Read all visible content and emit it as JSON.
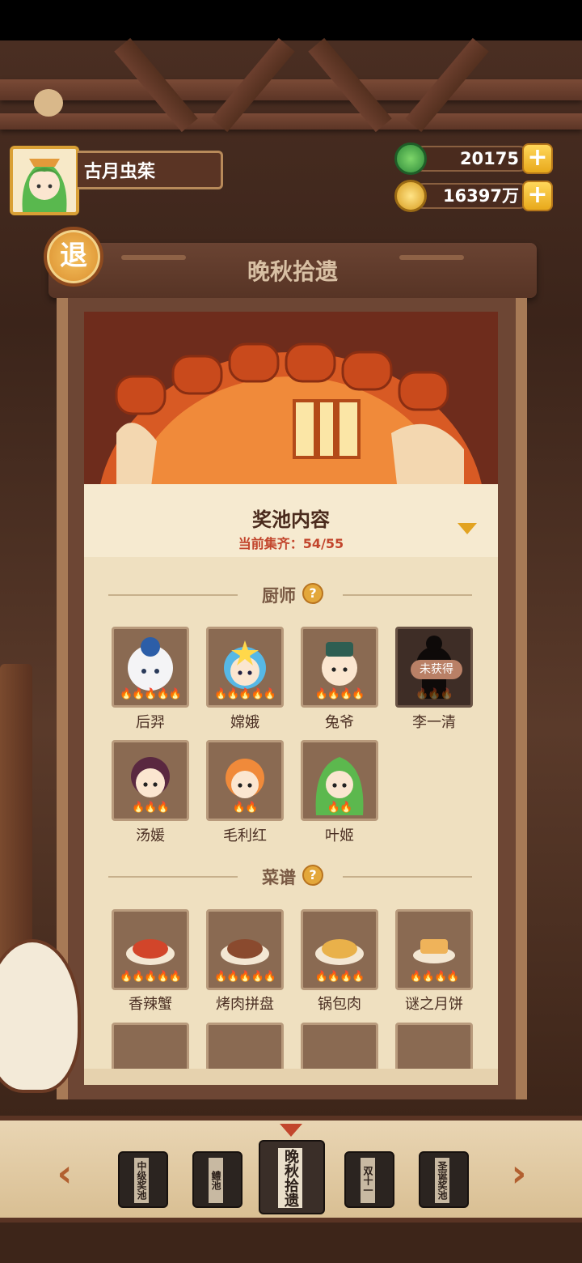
{
  "player": {
    "name": "古月虫茱"
  },
  "currencies": [
    {
      "icon": "jade-icon",
      "value": "20175",
      "color": "#3ca84a"
    },
    {
      "icon": "coin-icon",
      "value": "16397万",
      "color": "#e6b530"
    }
  ],
  "exit_label": "退",
  "title": "晚秋拾遗",
  "pool": {
    "title": "奖池内容",
    "progress": "当前集齐：54/55"
  },
  "chefs_section": {
    "title": "厨师",
    "items": [
      {
        "name": "后羿",
        "stars": 5,
        "owned": true
      },
      {
        "name": "嫦娥",
        "stars": 5,
        "owned": true
      },
      {
        "name": "兔爷",
        "stars": 4,
        "owned": true
      },
      {
        "name": "李一清",
        "stars": 3,
        "owned": false,
        "badge": "未获得"
      },
      {
        "name": "汤媛",
        "stars": 3,
        "owned": true
      },
      {
        "name": "毛利红",
        "stars": 2,
        "owned": true
      },
      {
        "name": "叶姬",
        "stars": 2,
        "owned": true
      }
    ]
  },
  "recipes_section": {
    "title": "菜谱",
    "items": [
      {
        "name": "香辣蟹",
        "stars": 5
      },
      {
        "name": "烤肉拼盘",
        "stars": 5
      },
      {
        "name": "锅包肉",
        "stars": 4
      },
      {
        "name": "谜之月饼",
        "stars": 4
      }
    ]
  },
  "tabs": [
    {
      "label": "中级奖池",
      "active": false
    },
    {
      "label": "鳢池",
      "active": false
    },
    {
      "label": "晚秋拾遗",
      "active": true
    },
    {
      "label": "双十一",
      "active": false
    },
    {
      "label": "圣诞奖池",
      "active": false
    }
  ],
  "arrows": {
    "left": "‹",
    "right": "›"
  }
}
